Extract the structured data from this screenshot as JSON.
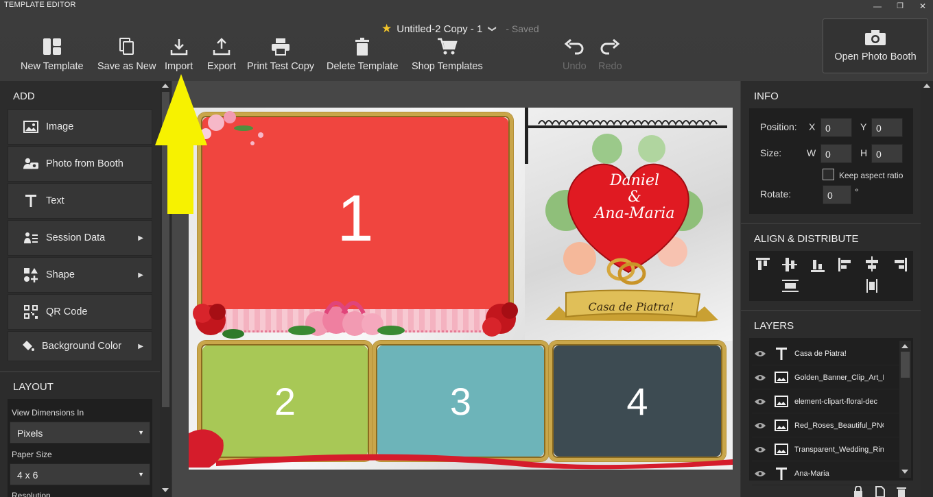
{
  "window": {
    "app_title": "TEMPLATE EDITOR",
    "minimize_icon": "minimize-icon",
    "restore_icon": "restore-icon",
    "close_icon": "close-icon",
    "minimize_glyph": "—",
    "restore_glyph": "❐",
    "close_glyph": "✕"
  },
  "document": {
    "title": "Untitled-2 Copy - 1",
    "status": "- Saved",
    "star_glyph": "★",
    "chevron_glyph": "❯"
  },
  "toolbar": {
    "new_template": "New Template",
    "save_as_new": "Save as New",
    "import": "Import",
    "export": "Export",
    "print_test_copy": "Print Test Copy",
    "delete_template": "Delete Template",
    "shop_templates": "Shop Templates",
    "undo": "Undo",
    "redo": "Redo",
    "open_photo_booth": "Open Photo Booth"
  },
  "add_panel": {
    "heading": "ADD",
    "items": [
      {
        "label": "Image",
        "icon": "image-icon",
        "submenu": false
      },
      {
        "label": "Photo from Booth",
        "icon": "camera-people-icon",
        "submenu": false
      },
      {
        "label": "Text",
        "icon": "text-icon",
        "submenu": false
      },
      {
        "label": "Session Data",
        "icon": "session-data-icon",
        "submenu": true
      },
      {
        "label": "Shape",
        "icon": "shape-icon",
        "submenu": true
      },
      {
        "label": "QR Code",
        "icon": "qr-code-icon",
        "submenu": false
      },
      {
        "label": "Background Color",
        "icon": "paint-bucket-icon",
        "submenu": true
      }
    ],
    "submenu_glyph": "▶"
  },
  "layout_panel": {
    "heading": "LAYOUT",
    "view_dimensions_label": "View Dimensions In",
    "view_dimensions_value": "Pixels",
    "paper_size_label": "Paper Size",
    "paper_size_value": "4 x 6",
    "resolution_label": "Resolution",
    "caret_glyph": "▼"
  },
  "canvas": {
    "slots": [
      "1",
      "2",
      "3",
      "4"
    ],
    "slot_colors": [
      "#f0453f",
      "#a8c856",
      "#6db4b9",
      "#3d4b52"
    ],
    "heart_text_line1": "Daniel",
    "heart_text_amp": "&",
    "heart_text_line2": "Ana-Maria",
    "banner_text": "Casa de Piatra!"
  },
  "info_panel": {
    "heading": "INFO",
    "position_label": "Position:",
    "x_label": "X",
    "x_value": "0",
    "y_label": "Y",
    "y_value": "0",
    "size_label": "Size:",
    "w_label": "W",
    "w_value": "0",
    "h_label": "H",
    "h_value": "0",
    "keep_aspect_ratio": "Keep aspect ratio",
    "keep_aspect_checked": false,
    "rotate_label": "Rotate:",
    "rotate_value": "0",
    "degree": "°"
  },
  "align_panel": {
    "heading": "ALIGN & DISTRIBUTE"
  },
  "layers_panel": {
    "heading": "LAYERS",
    "layers": [
      {
        "name": "Casa de Piatra!",
        "type": "text"
      },
      {
        "name": "Golden_Banner_Clip_Art_P",
        "type": "image"
      },
      {
        "name": "element-clipart-floral-dec",
        "type": "image"
      },
      {
        "name": "Red_Roses_Beautiful_PNG",
        "type": "image"
      },
      {
        "name": "Transparent_Wedding_Rin",
        "type": "image"
      },
      {
        "name": "Ana-Maria",
        "type": "text"
      }
    ]
  },
  "annotation": {
    "arrow_color": "#f7f200"
  }
}
